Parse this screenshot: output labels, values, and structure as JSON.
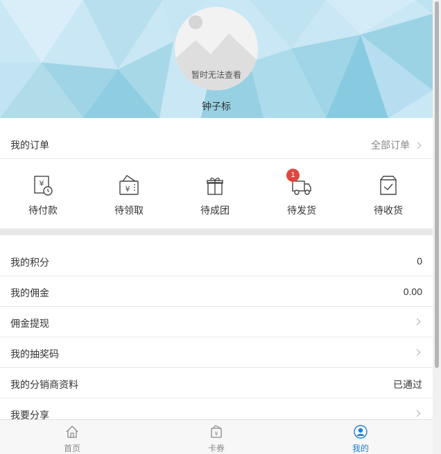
{
  "profile": {
    "avatar_caption": "暂时无法查看",
    "username": "钟子标"
  },
  "orders": {
    "title": "我的订单",
    "all_label": "全部订单",
    "statuses": [
      {
        "label": "待付款",
        "icon": "pending-payment-icon"
      },
      {
        "label": "待领取",
        "icon": "pending-pickup-icon"
      },
      {
        "label": "待成团",
        "icon": "pending-group-gift-icon"
      },
      {
        "label": "待发货",
        "icon": "pending-shipment-truck-icon",
        "badge": "1"
      },
      {
        "label": "待收货",
        "icon": "pending-receipt-box-icon"
      }
    ]
  },
  "menu": [
    {
      "label": "我的积分",
      "value": "0"
    },
    {
      "label": "我的佣金",
      "value": "0.00"
    },
    {
      "label": "佣金提现",
      "value": ""
    },
    {
      "label": "我的抽奖码",
      "value": ""
    },
    {
      "label": "我的分销商资料",
      "value": "已通过"
    },
    {
      "label": "我要分享",
      "value": ""
    }
  ],
  "tabbar": {
    "items": [
      {
        "label": "首页",
        "icon": "home-icon"
      },
      {
        "label": "卡券",
        "icon": "coupon-icon"
      },
      {
        "label": "我的",
        "icon": "user-icon"
      }
    ],
    "active": "我的",
    "active_color": "#1e7fd6"
  },
  "colors": {
    "badge": "#e0463f",
    "header_bg": "#cde8f3"
  }
}
